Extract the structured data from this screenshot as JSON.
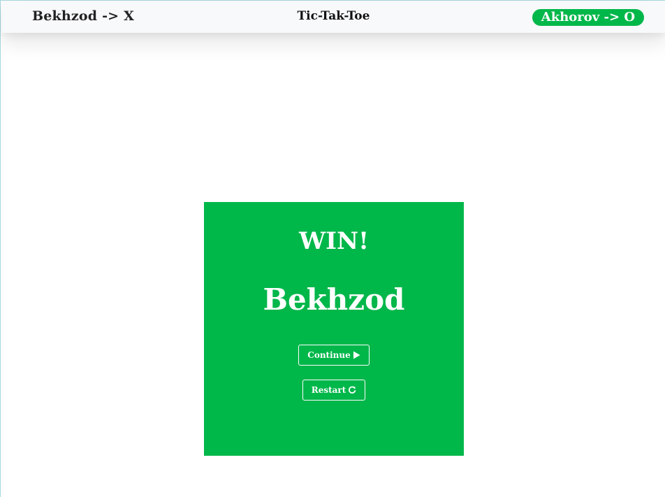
{
  "header": {
    "player_x": "Bekhzod -> X",
    "title": "Tic-Tak-Toe",
    "player_o": "Akhorov -> O"
  },
  "result": {
    "status": "WIN!",
    "winner": "Bekhzod"
  },
  "actions": {
    "continue_label": "Continue",
    "continue_icon": "play-icon",
    "restart_label": "Restart",
    "restart_icon": "refresh-icon"
  },
  "colors": {
    "accent_green": "#00b74a",
    "header_bg": "#f7f9fa",
    "text_dark": "#222222"
  }
}
